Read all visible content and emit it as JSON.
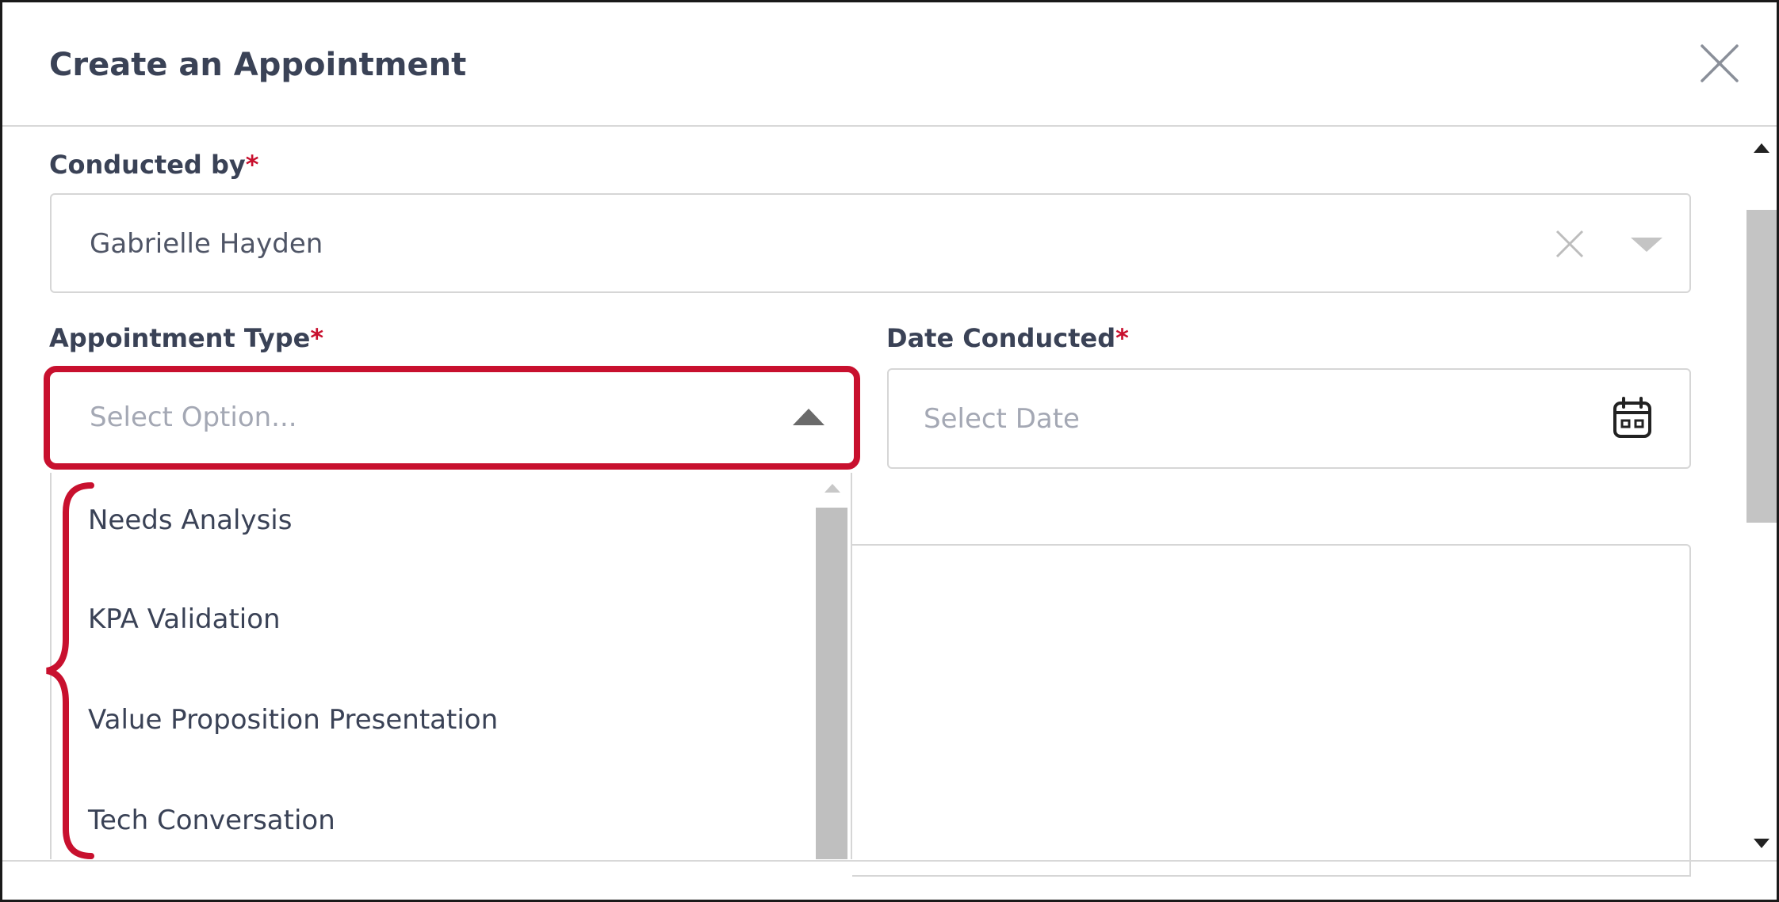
{
  "modal": {
    "title": "Create an Appointment",
    "close_icon": "close-icon"
  },
  "conducted_by": {
    "label": "Conducted by",
    "required_mark": "*",
    "value": "Gabrielle Hayden",
    "clear_icon": "clear-icon",
    "caret_icon": "caret-down-icon"
  },
  "appointment_type": {
    "label": "Appointment Type",
    "required_mark": "*",
    "placeholder": "Select Option...",
    "caret_icon": "caret-up-icon",
    "options": [
      "Needs Analysis",
      "KPA Validation",
      "Value Proposition Presentation",
      "Tech Conversation"
    ]
  },
  "date_conducted": {
    "label": "Date Conducted",
    "required_mark": "*",
    "placeholder": "Select Date",
    "calendar_icon": "calendar-icon"
  },
  "colors": {
    "highlight": "#c8102e",
    "text": "#3a4256",
    "placeholder": "#a4a8b4",
    "border": "#d6d6d6",
    "scrollbar_thumb": "#bfbfbf"
  }
}
